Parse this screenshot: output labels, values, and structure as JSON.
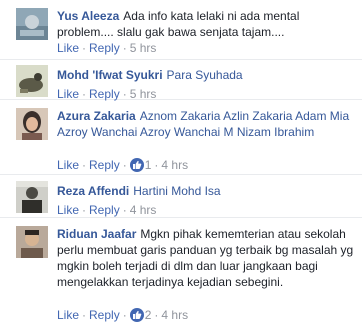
{
  "comments": [
    {
      "name": "Yus Aleeza",
      "text": "Ada info kata lelaki ni ada mental problem.... slalu gak bawa senjata tajam....",
      "like": "Like",
      "reply": "Reply",
      "time": "5 hrs"
    },
    {
      "name": "Mohd 'Ifwat Syukri",
      "text": "Para Syuhada",
      "like": "Like",
      "reply": "Reply",
      "time": "5 hrs"
    },
    {
      "name": "Azura Zakaria",
      "text": "Aznom Zakaria Azlin Zakaria Adam Mia Azroy Wanchai Azroy Wanchai M Nizam Ibrahim",
      "like": "Like",
      "reply": "Reply",
      "reactions": "1",
      "time": "4 hrs"
    },
    {
      "name": "Reza Affendi",
      "text": "Hartini Mohd Isa",
      "like": "Like",
      "reply": "Reply",
      "time": "4 hrs"
    },
    {
      "name": "Riduan Jaafar",
      "text": "Mgkn pihak kememterian atau sekolah perlu membuat garis panduan yg terbaik bg masalah yg mgkin boleh terjadi di dlm dan luar jangkaan bagi mengelakkan terjadinya kejadian sebegini.",
      "like": "Like",
      "reply": "Reply",
      "reactions": "2",
      "time": "4 hrs"
    }
  ],
  "separator": "·",
  "colors": {
    "name": "#365899",
    "link": "#4267b2",
    "meta": "#90949c",
    "like_badge": "#4267b2"
  },
  "icons": {
    "reaction": "thumbs-up-icon"
  }
}
